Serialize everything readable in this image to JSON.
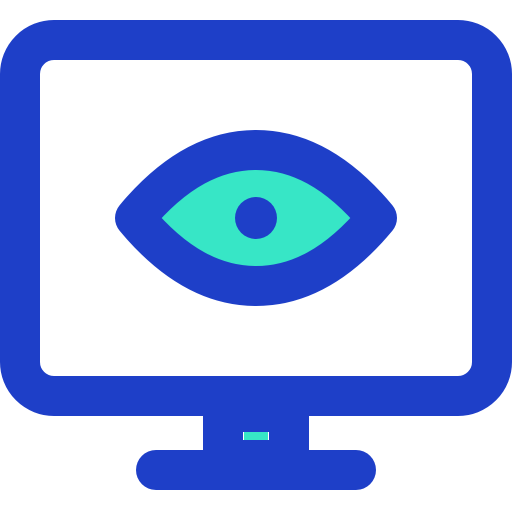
{
  "icon": {
    "name": "monitor-eye-icon",
    "colors": {
      "outline": "#1E3FC8",
      "accent": "#37E6C6",
      "background": "#FFFFFF"
    }
  }
}
